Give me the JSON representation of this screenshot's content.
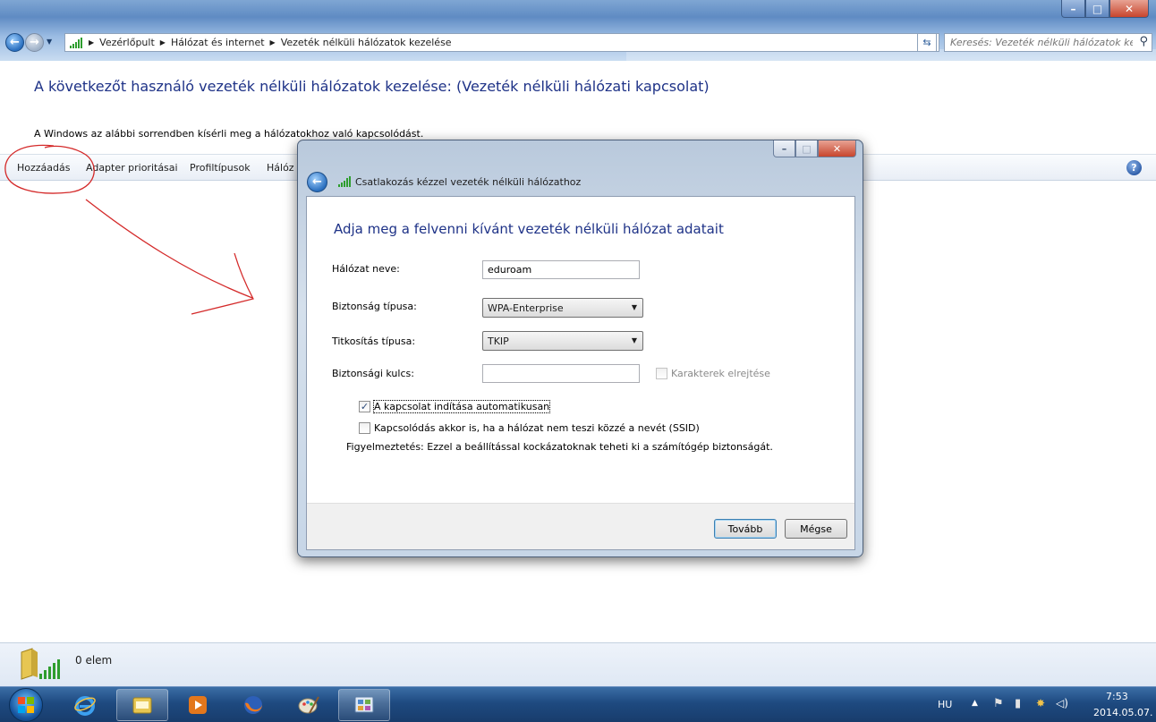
{
  "window": {
    "breadcrumb": [
      "Vezérlőpult",
      "Hálózat és internet",
      "Vezeték nélküli hálózatok kezelése"
    ],
    "search_placeholder": "Keresés: Vezeték nélküli hálózatok kez..."
  },
  "page": {
    "heading": "A következőt használó vezeték nélküli hálózatok kezelése: (Vezeték nélküli hálózati kapcsolat)",
    "subtitle": "A Windows az alábbi sorrendben kísérli meg a hálózatokhoz való kapcsolódást.",
    "toolbar": [
      "Hozzáadás",
      "Adapter prioritásai",
      "Profiltípusok",
      "Hálóz"
    ]
  },
  "status": {
    "count_text": "0 elem"
  },
  "dialog": {
    "title": "Csatlakozás kézzel vezeték nélküli hálózathoz",
    "heading": "Adja meg a felvenni kívánt vezeték nélküli hálózat adatait",
    "network_name_label": "Hálózat neve:",
    "network_name_value": "eduroam",
    "security_type_label": "Biztonság típusa:",
    "security_type_value": "WPA-Enterprise",
    "encryption_type_label": "Titkosítás típusa:",
    "encryption_type_value": "TKIP",
    "security_key_label": "Biztonsági kulcs:",
    "security_key_value": "",
    "hide_chars_label": "Karakterek elrejtése",
    "auto_connect_label": "A kapcsolat indítása automatikusan",
    "auto_connect_checked": true,
    "hidden_ssid_label": "Kapcsolódás akkor is, ha a hálózat nem teszi közzé a nevét (SSID)",
    "warning": "Figyelmeztetés: Ezzel a beállítással kockázatoknak teheti ki a számítógép biztonságát.",
    "next_button": "Tovább",
    "cancel_button": "Mégse"
  },
  "taskbar": {
    "language": "HU",
    "time": "7:53",
    "date": "2014.05.07."
  },
  "colors": {
    "heading_blue": "#1e3287",
    "taskbar": "#1e4a80",
    "close_red": "#c7452d"
  }
}
